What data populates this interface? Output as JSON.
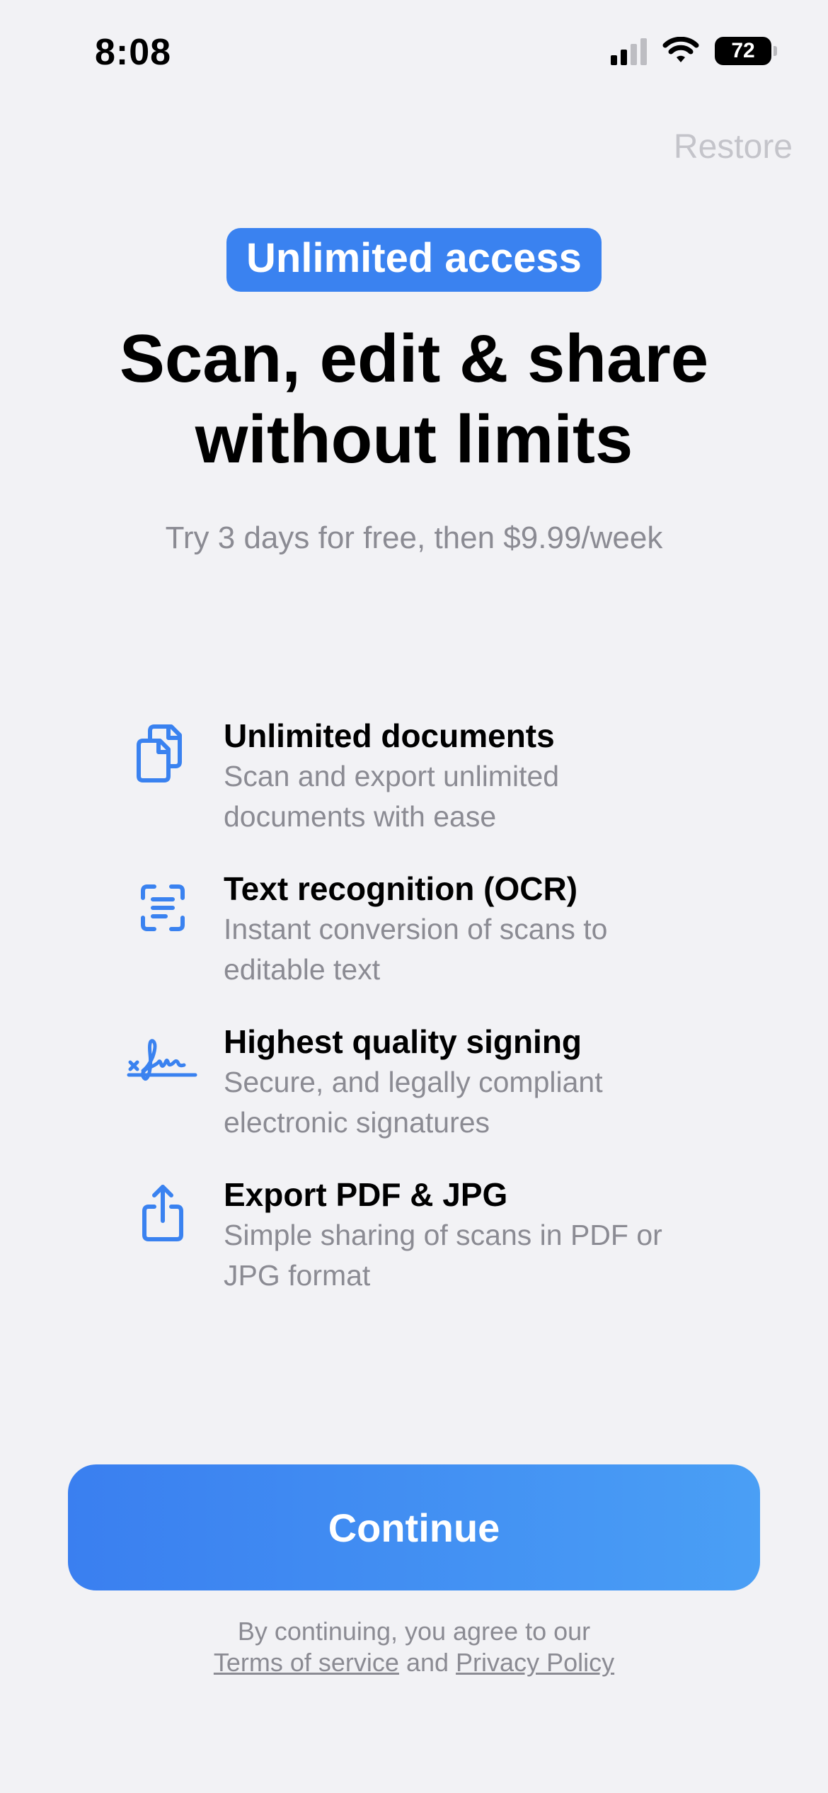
{
  "status_bar": {
    "time": "8:08",
    "battery_level": "72"
  },
  "header": {
    "restore_label": "Restore"
  },
  "badge": {
    "label": "Unlimited access"
  },
  "headline": {
    "line1": "Scan, edit & share",
    "line2": "without limits"
  },
  "subtitle": "Try 3 days for free, then $9.99/week",
  "features": [
    {
      "icon": "documents-icon",
      "title": "Unlimited documents",
      "desc_line1": "Scan and export unlimited",
      "desc_line2": "documents with ease"
    },
    {
      "icon": "text-scan-icon",
      "title": "Text recognition (OCR)",
      "desc_line1": "Instant conversion of scans to",
      "desc_line2": "editable text"
    },
    {
      "icon": "signature-icon",
      "title": "Highest quality signing",
      "desc_line1": "Secure, and legally compliant",
      "desc_line2": "electronic signatures"
    },
    {
      "icon": "share-icon",
      "title": "Export PDF & JPG",
      "desc_line1": "Simple sharing of scans in PDF or",
      "desc_line2": "JPG format"
    }
  ],
  "cta": {
    "label": "Continue"
  },
  "legal": {
    "line1": "By continuing, you agree to our",
    "terms_label": "Terms of service",
    "and": "and",
    "privacy_label": "Privacy Policy"
  },
  "colors": {
    "accent": "#3a82f0",
    "background": "#f2f2f5",
    "muted_text": "#8b8b93",
    "restore_text": "#c4c4ca"
  }
}
